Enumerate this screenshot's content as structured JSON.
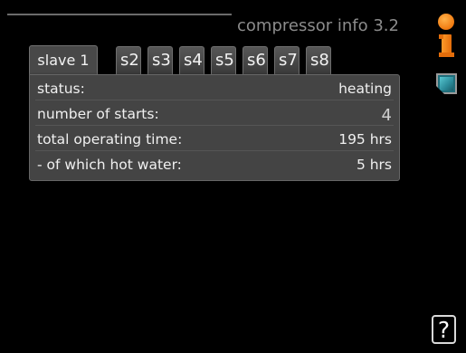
{
  "header": {
    "title": "compressor info 3.2"
  },
  "tabs": [
    {
      "label": "slave 1",
      "active": true
    },
    {
      "label": "s2",
      "active": false
    },
    {
      "label": "s3",
      "active": false
    },
    {
      "label": "s4",
      "active": false
    },
    {
      "label": "s5",
      "active": false
    },
    {
      "label": "s6",
      "active": false
    },
    {
      "label": "s7",
      "active": false
    },
    {
      "label": "s8",
      "active": false
    }
  ],
  "rows": [
    {
      "label": "status:",
      "value": "heating"
    },
    {
      "label": "number of starts:",
      "value": "4"
    },
    {
      "label": "total operating time:",
      "value": "195 hrs"
    },
    {
      "label": "- of which hot water:",
      "value": "5 hrs"
    }
  ],
  "sidebar": {
    "info_icon": "info-icon",
    "document_icon": "document-icon",
    "help_label": "?"
  },
  "colors": {
    "accent": "#f07a10",
    "teal": "#2b8a99"
  }
}
